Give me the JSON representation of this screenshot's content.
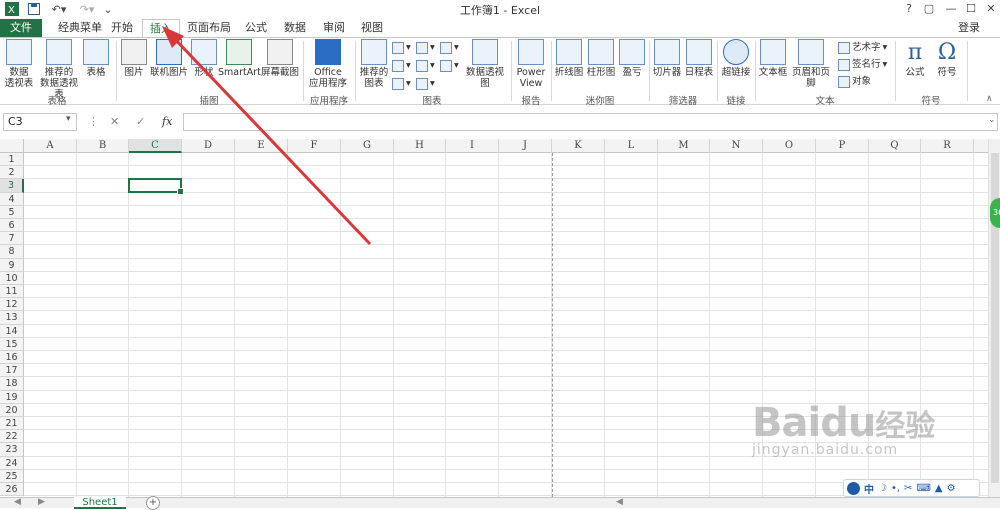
{
  "titlebar": {
    "title": "工作簿1 - Excel",
    "excel_icon": "excel-logo",
    "undo_label": "↶",
    "redo_label": "↷",
    "help": "?",
    "restore": "▢",
    "minimize": "—",
    "maximize": "☐",
    "close": "✕"
  },
  "tabs": [
    {
      "id": "file",
      "label": "文件"
    },
    {
      "id": "classic",
      "label": "经典菜单"
    },
    {
      "id": "home",
      "label": "开始"
    },
    {
      "id": "insert",
      "label": "插入"
    },
    {
      "id": "layout",
      "label": "页面布局"
    },
    {
      "id": "formulas",
      "label": "公式"
    },
    {
      "id": "data",
      "label": "数据"
    },
    {
      "id": "review",
      "label": "审阅"
    },
    {
      "id": "view",
      "label": "视图"
    }
  ],
  "login": "登录",
  "ribbon": {
    "groups": {
      "tables": "表格",
      "illustrations": "插图",
      "apps": "应用程序",
      "charts": "图表",
      "reports": "报告",
      "sparklines": "迷你图",
      "filters": "筛选器",
      "links": "链接",
      "text": "文本",
      "symbols": "符号"
    },
    "buttons": {
      "pivot_table": "数据\n透视表",
      "recommended_pivot": "推荐的\n数据透视表",
      "table": "表格",
      "picture": "图片",
      "online_picture": "联机图片",
      "shapes": "形状",
      "smartart": "SmartArt",
      "screenshot": "屏幕截图",
      "office_apps": "Office\n应用程序",
      "recommended_charts": "推荐的\n图表",
      "pivot_chart": "数据透视图",
      "power_view": "Power\nView",
      "line_spark": "折线图",
      "column_spark": "柱形图",
      "winloss_spark": "盈亏",
      "slicer": "切片器",
      "timeline": "日程表",
      "hyperlink": "超链接",
      "textbox": "文本框",
      "header_footer": "页眉和页脚",
      "wordart": "艺术字",
      "signature": "签名行",
      "object": "对象",
      "equation": "公式",
      "symbol": "符号"
    }
  },
  "formula_bar": {
    "name_box": "C3",
    "cancel": "✕",
    "enter": "✓",
    "fx": "fx",
    "value": ""
  },
  "grid": {
    "columns": [
      "A",
      "B",
      "C",
      "D",
      "E",
      "F",
      "G",
      "H",
      "I",
      "J",
      "K",
      "L",
      "M",
      "N",
      "O",
      "P",
      "Q",
      "R"
    ],
    "rows": [
      "1",
      "2",
      "3",
      "4",
      "5",
      "6",
      "7",
      "8",
      "9",
      "10",
      "11",
      "12",
      "13",
      "14",
      "15",
      "16",
      "17",
      "18",
      "19",
      "20",
      "21",
      "22",
      "23",
      "24",
      "25",
      "26"
    ],
    "active_cell": "C3"
  },
  "sheets": {
    "tabs": [
      "Sheet1"
    ],
    "add": "+"
  },
  "colors": {
    "excel_green": "#217346",
    "annotation_red": "#d9383a"
  },
  "ime": {
    "lang": "中"
  },
  "watermark": {
    "text": "Baidu",
    "cn": "经验",
    "url": "jingyan.baidu.com"
  }
}
